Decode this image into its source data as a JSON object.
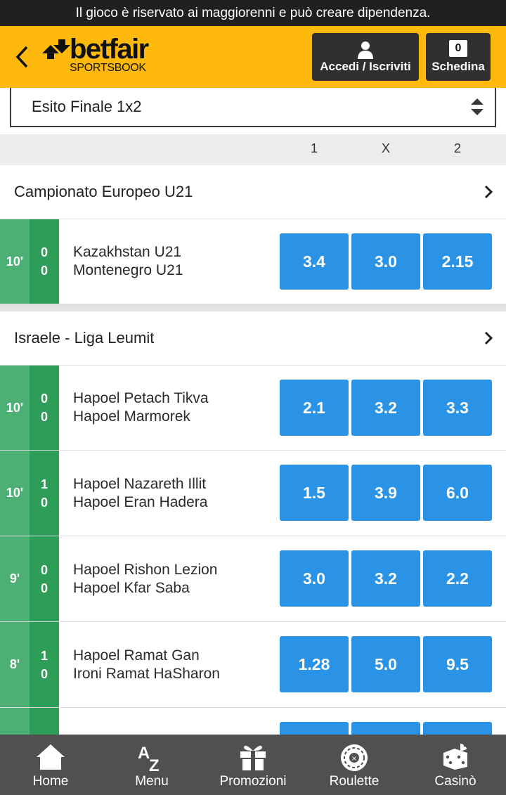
{
  "disclaimer": "Il gioco è riservato ai maggiorenni e può creare dipendenza.",
  "brand": {
    "name": "betfair",
    "sub": "SPORTSBOOK",
    "color": "#ffb80c"
  },
  "header": {
    "login_label": "Accedi / Iscriviti",
    "betslip_label": "Schedina",
    "betslip_count": "0"
  },
  "market_select": {
    "value": "Esito Finale 1x2"
  },
  "columns": [
    "1",
    "X",
    "2"
  ],
  "sections": [
    {
      "competition": "Campionato Europeo U21",
      "events": [
        {
          "time": "10'",
          "score_home": "0",
          "score_away": "0",
          "home": "Kazakhstan U21",
          "away": "Montenegro U21",
          "odds": [
            "3.4",
            "3.0",
            "2.15"
          ]
        }
      ]
    },
    {
      "competition": "Israele - Liga Leumit",
      "events": [
        {
          "time": "10'",
          "score_home": "0",
          "score_away": "0",
          "home": "Hapoel Petach Tikva",
          "away": "Hapoel Marmorek",
          "odds": [
            "2.1",
            "3.2",
            "3.3"
          ]
        },
        {
          "time": "10'",
          "score_home": "1",
          "score_away": "0",
          "home": "Hapoel Nazareth Illit",
          "away": "Hapoel Eran Hadera",
          "odds": [
            "1.5",
            "3.9",
            "6.0"
          ]
        },
        {
          "time": "9'",
          "score_home": "0",
          "score_away": "0",
          "home": "Hapoel Rishon Lezion",
          "away": "Hapoel Kfar Saba",
          "odds": [
            "3.0",
            "3.2",
            "2.2"
          ]
        },
        {
          "time": "8'",
          "score_home": "1",
          "score_away": "0",
          "home": "Hapoel Ramat Gan",
          "away": "Ironi Ramat HaSharon",
          "odds": [
            "1.28",
            "5.0",
            "9.5"
          ]
        }
      ]
    }
  ],
  "bottom_nav": [
    {
      "label": "Home",
      "icon": "home-icon"
    },
    {
      "label": "Menu",
      "icon": "az-icon"
    },
    {
      "label": "Promozioni",
      "icon": "gift-icon"
    },
    {
      "label": "Roulette",
      "icon": "roulette-icon"
    },
    {
      "label": "Casinò",
      "icon": "dice-icon"
    }
  ],
  "colors": {
    "odds_button": "#2a93e6",
    "live_time": "#4caf73",
    "live_score": "#2e9d58"
  }
}
